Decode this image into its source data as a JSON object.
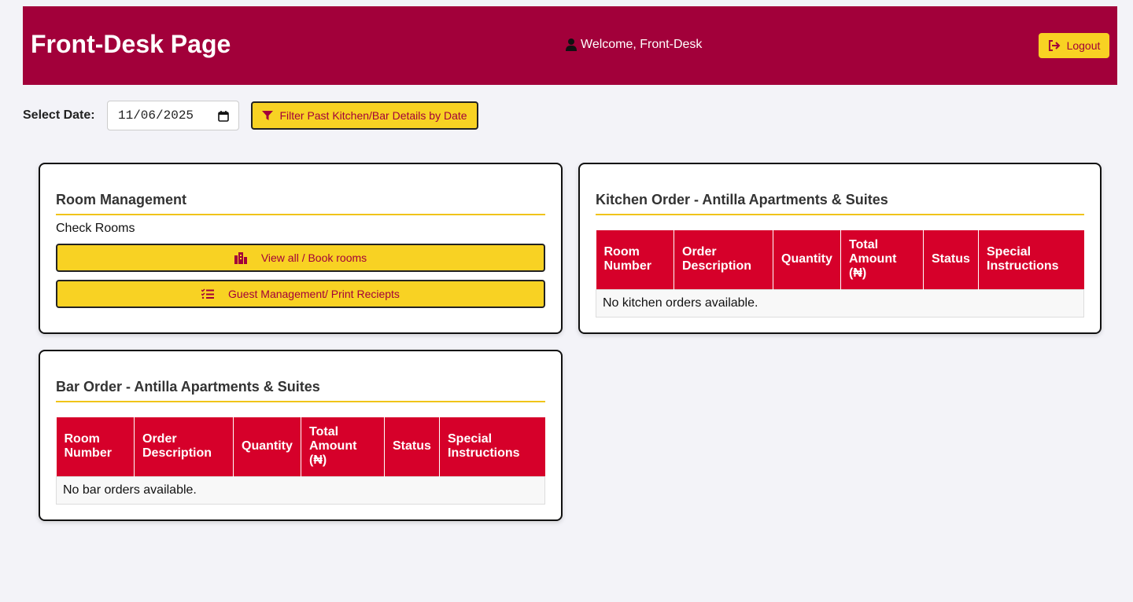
{
  "header": {
    "title": "Front-Desk Page",
    "welcome": "Welcome, Front-Desk",
    "logout_label": "Logout",
    "user_icon": "user-icon",
    "logout_icon": "sign-out-icon"
  },
  "filter": {
    "label": "Select Date:",
    "date_value": "11/06/2025",
    "button_label": "Filter Past Kitchen/Bar Details by Date",
    "button_icon": "filter-icon"
  },
  "room_management": {
    "title": "Room Management",
    "check_label": "Check Rooms",
    "view_button": "View all / Book rooms",
    "view_icon": "rooms-icon",
    "guest_button": "Guest Management/ Print Reciepts",
    "guest_icon": "list-check-icon"
  },
  "kitchen": {
    "title": "Kitchen Order - Antilla Apartments & Suites",
    "columns": [
      "Room Number",
      "Order Description",
      "Quantity",
      "Total Amount (₦)",
      "Status",
      "Special Instructions"
    ],
    "empty": "No kitchen orders available."
  },
  "bar": {
    "title": "Bar Order - Antilla Apartments & Suites",
    "columns": [
      "Room Number",
      "Order Description",
      "Quantity",
      "Total Amount (₦)",
      "Status",
      "Special Instructions"
    ],
    "empty": "No bar orders available."
  },
  "colors": {
    "header_bg": "#a2003a",
    "accent_yellow": "#f8d223",
    "table_header": "#d6002a"
  }
}
